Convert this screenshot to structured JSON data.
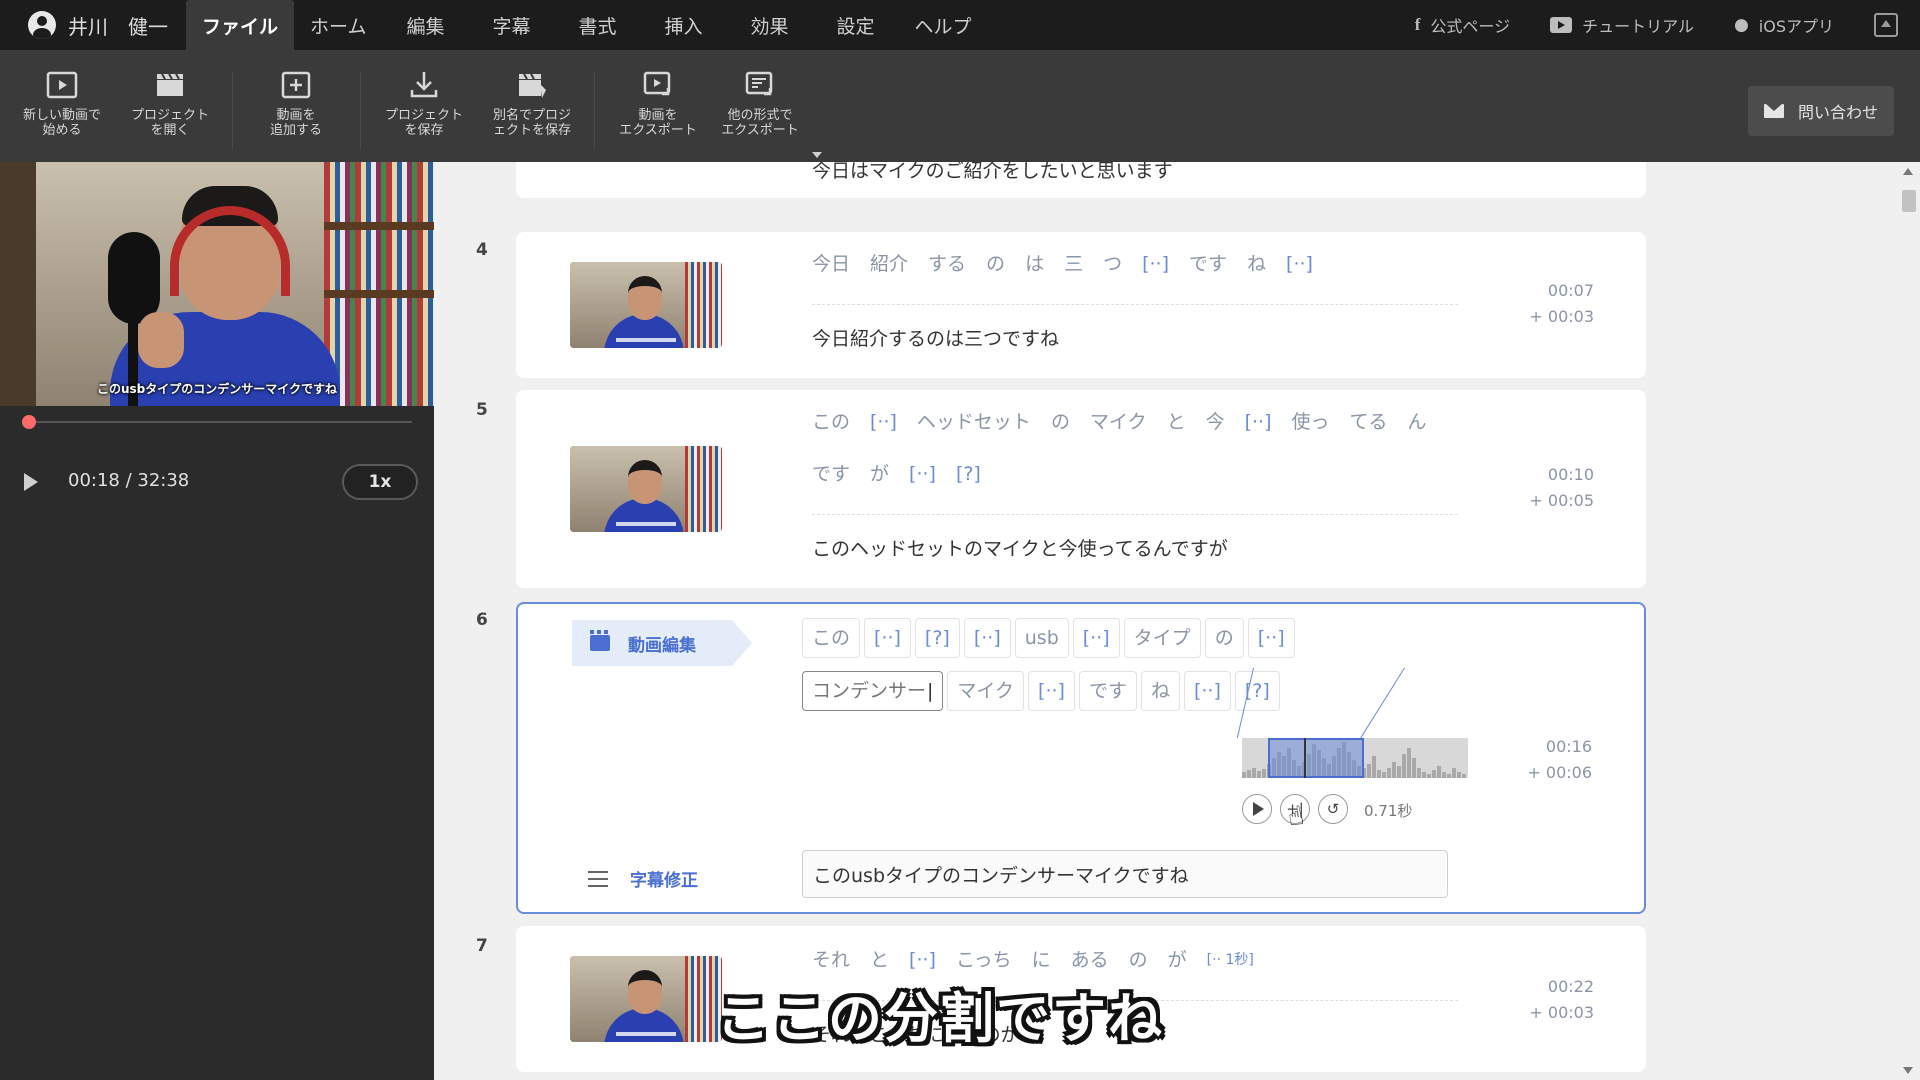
{
  "user": {
    "name": "井川　健一"
  },
  "menu": [
    "ファイル",
    "ホーム",
    "編集",
    "字幕",
    "書式",
    "挿入",
    "効果",
    "設定",
    "ヘルプ"
  ],
  "menu_active_index": 0,
  "links": {
    "official": "公式ページ",
    "tutorial": "チュートリアル",
    "ios": "iOSアプリ"
  },
  "toolbar": {
    "new_video": "新しい動画で\n始める",
    "open_project": "プロジェクト\nを開く",
    "add_video": "動画を\n追加する",
    "save_project": "プロジェクト\nを保存",
    "save_as": "別名でプロジ\nェクトを保存",
    "export_video": "動画を\nエクスポート",
    "export_other": "他の形式で\nエクスポート",
    "contact": "問い合わせ"
  },
  "player": {
    "video_caption": "このusbタイプのコンデンサーマイクですね",
    "time": "00:18 / 32:38",
    "speed": "1x",
    "progress": 0.009
  },
  "rows": {
    "r3": {
      "caption": "今日はマイクのご紹介をしたいと思います"
    },
    "r4": {
      "num": "4",
      "tokens": [
        "今日",
        "紹介",
        "する",
        "の",
        "は",
        "三",
        "つ",
        "[··]",
        "です",
        "ね",
        "[··]"
      ],
      "caption": "今日紹介するのは三つですね",
      "start": "00:07",
      "dur": "+ 00:03"
    },
    "r5": {
      "num": "5",
      "tokens": [
        "この",
        "[··]",
        "ヘッドセット",
        "の",
        "マイク",
        "と",
        "今",
        "[··]",
        "使っ",
        "てる",
        "ん",
        "です",
        "が",
        "[··]",
        "[?]"
      ],
      "caption": "このヘッドセットのマイクと今使ってるんですが",
      "start": "00:10",
      "dur": "+ 00:05"
    },
    "r6": {
      "num": "6",
      "tag": "動画編集",
      "tokens": [
        "この",
        "[··]",
        "[?]",
        "[··]",
        "usb",
        "[··]",
        "タイプ",
        "の",
        "[··]",
        "コンデンサー",
        "マイク",
        "[··]",
        "です",
        "ね",
        "[··]",
        "[?]"
      ],
      "edit_index": 9,
      "segment_duration": "0.71秒",
      "subtitle_label": "字幕修正",
      "subtitle_value": "このusbタイプのコンデンサーマイクですね",
      "start": "00:16",
      "dur": "+ 00:06"
    },
    "r7": {
      "num": "7",
      "tokens": [
        "それ",
        "と",
        "[··]",
        "こっち",
        "に",
        "ある",
        "の",
        "が",
        "[·· 1秒]"
      ],
      "caption": "それとこっちにあるのが",
      "start": "00:22",
      "dur": "+ 00:03"
    }
  },
  "overlay_caption": "ここの分割ですね"
}
